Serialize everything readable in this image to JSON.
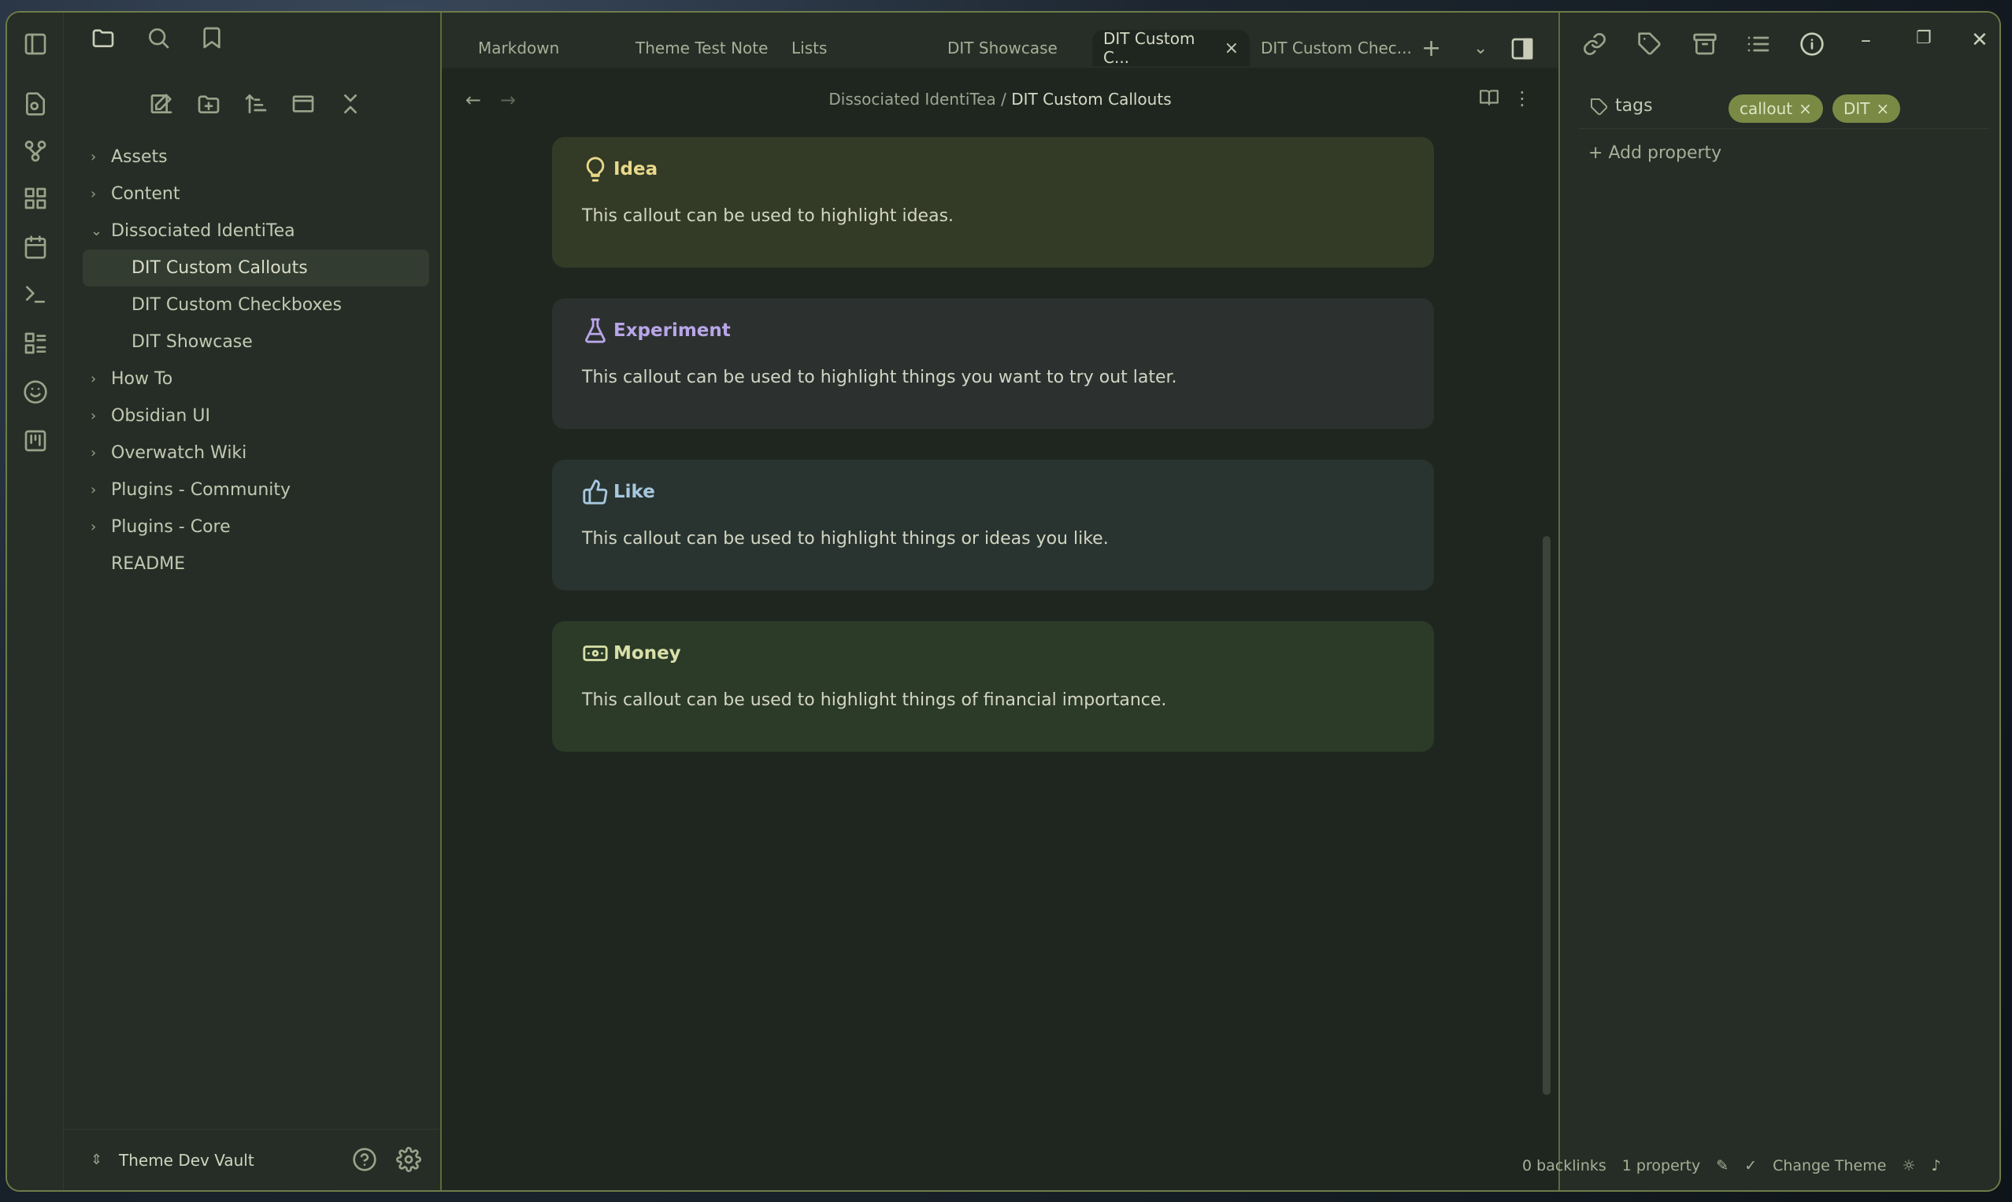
{
  "sidebar": {
    "tree": [
      {
        "label": "Assets",
        "type": "folder",
        "expanded": false
      },
      {
        "label": "Content",
        "type": "folder",
        "expanded": false
      },
      {
        "label": "Dissociated IdentiTea",
        "type": "folder",
        "expanded": true
      },
      {
        "label": "DIT Custom Callouts",
        "type": "file",
        "child": true,
        "active": true
      },
      {
        "label": "DIT Custom Checkboxes",
        "type": "file",
        "child": true
      },
      {
        "label": "DIT Showcase",
        "type": "file",
        "child": true
      },
      {
        "label": "How To",
        "type": "folder",
        "expanded": false
      },
      {
        "label": "Obsidian UI",
        "type": "folder",
        "expanded": false
      },
      {
        "label": "Overwatch Wiki",
        "type": "folder",
        "expanded": false
      },
      {
        "label": "Plugins - Community",
        "type": "folder",
        "expanded": false
      },
      {
        "label": "Plugins - Core",
        "type": "folder",
        "expanded": false
      },
      {
        "label": "README",
        "type": "file"
      }
    ],
    "vault_name": "Theme Dev Vault"
  },
  "tabs": [
    {
      "label": "Markdown"
    },
    {
      "label": "Theme Test Note"
    },
    {
      "label": "Lists"
    },
    {
      "label": "DIT Showcase"
    },
    {
      "label": "DIT Custom C...",
      "active": true
    },
    {
      "label": "DIT Custom Chec..."
    }
  ],
  "breadcrumb": {
    "parent": "Dissociated IdentiTea",
    "separator": "/",
    "current": "DIT Custom Callouts"
  },
  "callouts": [
    {
      "title": "Idea",
      "body": "This callout can be used to highlight ideas.",
      "icon": "lightbulb-icon",
      "color": "#e8d98a",
      "bg": "#333a26"
    },
    {
      "title": "Experiment",
      "body": "This callout can be used to highlight things you want to try out later.",
      "icon": "flask-icon",
      "color": "#b9a6e8",
      "bg": "#2c3130"
    },
    {
      "title": "Like",
      "body": "This callout can be used to highlight things or ideas you like.",
      "icon": "thumbs-up-icon",
      "color": "#a8c8e0",
      "bg": "#293430"
    },
    {
      "title": "Money",
      "body": "This callout can be used to highlight things of financial importance.",
      "icon": "banknote-icon",
      "color": "#d8e0a8",
      "bg": "#2c3a28"
    }
  ],
  "properties": {
    "name": "tags",
    "tags": [
      "callout",
      "DIT"
    ],
    "add_label": "Add property"
  },
  "status": {
    "backlinks": "0 backlinks",
    "properties": "1 property",
    "theme": "Change Theme"
  }
}
